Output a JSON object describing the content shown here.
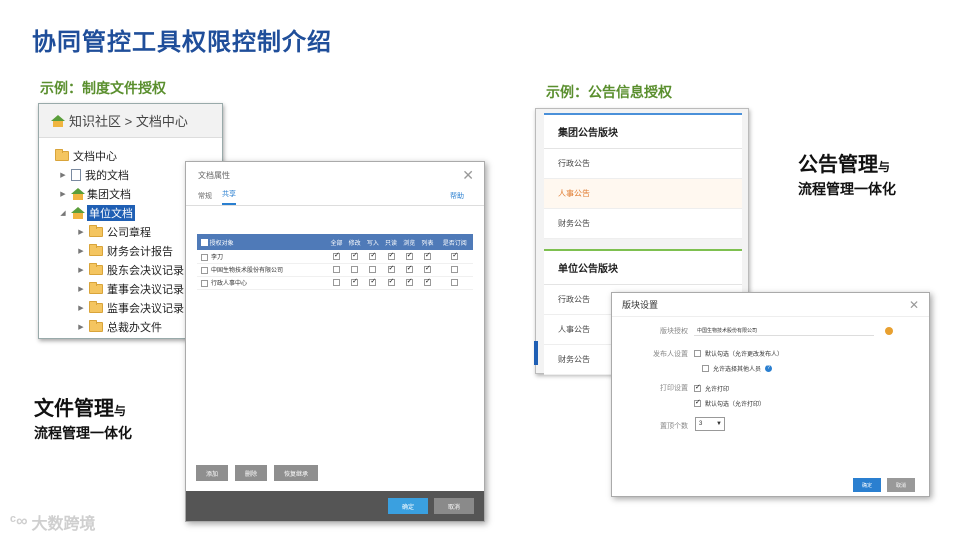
{
  "page": {
    "title": "协同管控工具权限控制介绍",
    "caption_left": "示例：制度文件授权",
    "caption_right": "示例：公告信息授权"
  },
  "tree": {
    "breadcrumb": "知识社区 > 文档中心",
    "items": [
      {
        "label": "文档中心",
        "icon": "folder-icon"
      },
      {
        "label": "我的文档",
        "icon": "document-icon"
      },
      {
        "label": "集团文档",
        "icon": "house-icon"
      },
      {
        "label": "单位文档",
        "icon": "house-icon",
        "selected": true
      },
      {
        "label": "公司章程",
        "icon": "folder-icon"
      },
      {
        "label": "财务会计报告",
        "icon": "folder-icon"
      },
      {
        "label": "股东会决议记录",
        "icon": "folder-icon"
      },
      {
        "label": "董事会决议记录",
        "icon": "folder-icon"
      },
      {
        "label": "监事会决议记录",
        "icon": "folder-icon"
      },
      {
        "label": "总裁办文件",
        "icon": "folder-icon"
      }
    ]
  },
  "doc_dialog": {
    "title": "文档属性",
    "tabs": [
      "常规",
      "共享"
    ],
    "active_tab": "共享",
    "help": "帮助",
    "columns": [
      "授权对象",
      "全部",
      "修改",
      "写入",
      "只读",
      "浏览",
      "列表",
      "是否订阅"
    ],
    "rows": [
      {
        "name": "李刀",
        "perms": [
          true,
          true,
          true,
          true,
          true,
          true,
          true
        ]
      },
      {
        "name": "中国生物技术股份有限公司",
        "perms": [
          false,
          false,
          false,
          true,
          true,
          true,
          false
        ]
      },
      {
        "name": "行政人事中心",
        "perms": [
          false,
          true,
          true,
          true,
          true,
          true,
          false
        ]
      }
    ],
    "buttons": [
      "添加",
      "删除",
      "恢复继承"
    ],
    "ok": "确定",
    "cancel": "取消"
  },
  "summary_left": {
    "line1": "文件管理",
    "yu": "与",
    "line2": "流程管理一体化"
  },
  "summary_right": {
    "line1": "公告管理",
    "yu": "与",
    "line2": "流程管理一体化"
  },
  "notice": {
    "group_header": "集团公告版块",
    "group_items": [
      "行政公告",
      "人事公告",
      "财务公告"
    ],
    "group_active": "人事公告",
    "unit_header": "单位公告版块",
    "unit_items": [
      "行政公告",
      "人事公告",
      "财务公告"
    ]
  },
  "block_dialog": {
    "title": "版块设置",
    "admin_label": "版块授权",
    "admin_value": "中国生物技术股份有限公司",
    "publisher_label": "发布人设置",
    "opt_default_editable": "默认勾选（允许更改发布人）",
    "opt_allow_select": "允许选择其他人员",
    "print_label": "打印设置",
    "opt_allow_print": "允许打印",
    "opt_default_print": "默认勾选（允许打印）",
    "topcount_label": "置顶个数",
    "topcount_value": "3",
    "ok": "确定",
    "cancel": "取消"
  },
  "watermark": "大数跨境"
}
